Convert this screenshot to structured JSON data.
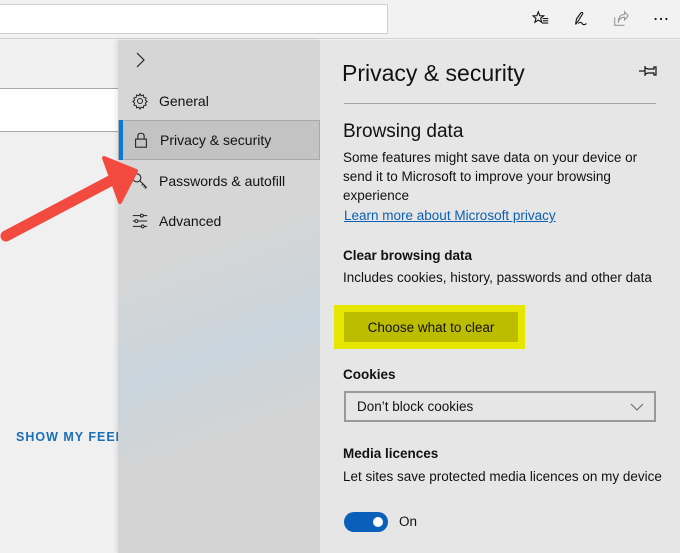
{
  "toolbar": {
    "address_value": "",
    "icons": [
      "favorites-list-icon",
      "pen-notes-icon",
      "share-icon",
      "more-icon"
    ]
  },
  "page": {
    "show_feed_label": "SHOW MY FEED"
  },
  "nav": {
    "items": [
      {
        "label": "General",
        "icon": "gear-icon"
      },
      {
        "label": "Privacy & security",
        "icon": "lock-icon",
        "active": true
      },
      {
        "label": "Passwords & autofill",
        "icon": "key-icon"
      },
      {
        "label": "Advanced",
        "icon": "sliders-icon"
      }
    ]
  },
  "panel": {
    "title": "Privacy & security",
    "browsing_data": {
      "heading": "Browsing data",
      "description": "Some features might save data on your device or send it to Microsoft to improve your browsing experience",
      "link": "Learn more about Microsoft privacy"
    },
    "clear_browsing_data": {
      "heading": "Clear browsing data",
      "description": "Includes cookies, history, passwords and other data",
      "button": "Choose what to clear"
    },
    "cookies": {
      "heading": "Cookies",
      "selected": "Don’t block cookies"
    },
    "media_licences": {
      "heading": "Media licences",
      "description": "Let sites save protected media licences on my device",
      "toggle_state": "On",
      "enabled": true
    }
  },
  "colors": {
    "accent": "#0a78d7",
    "toggle": "#0a5fba",
    "link": "#0c5fb3",
    "highlight": "#e6e600",
    "button_highlighted": "#bdbd00",
    "arrow": "#f24a3f"
  }
}
